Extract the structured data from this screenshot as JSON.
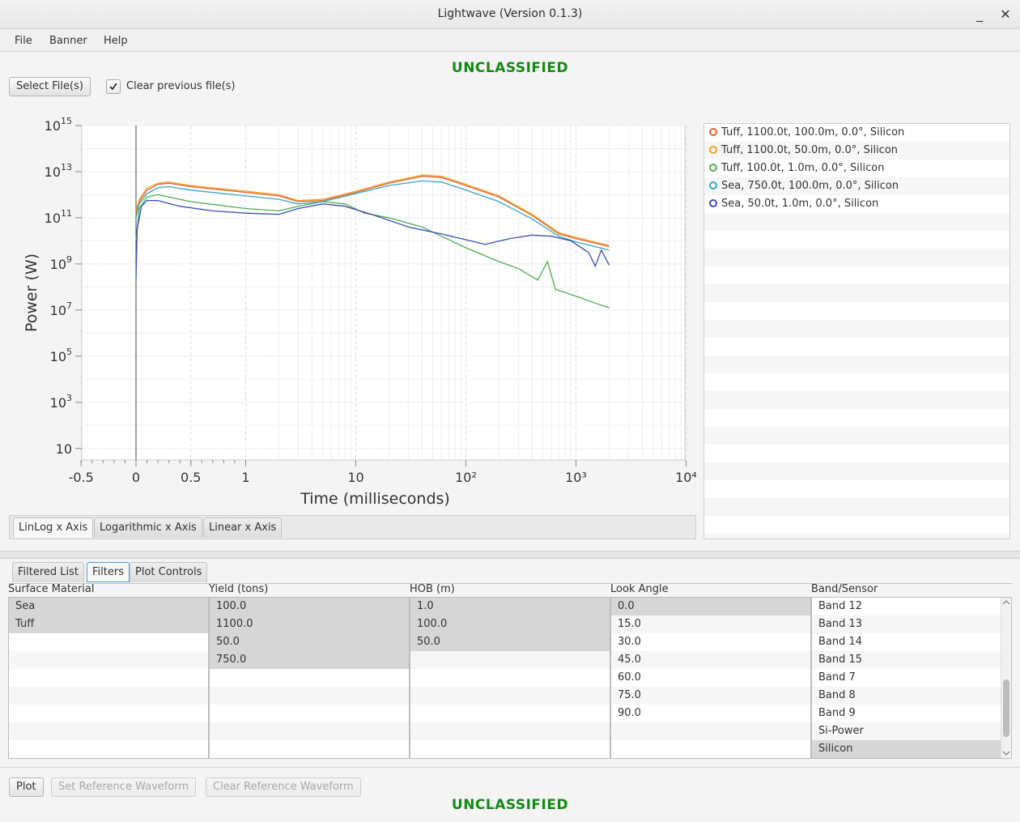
{
  "window": {
    "title": "Lightwave (Version 0.1.3)",
    "minimize": "_",
    "close": "✕"
  },
  "menu": [
    "File",
    "Banner",
    "Help"
  ],
  "banner": {
    "top": "UNCLASSIFIED",
    "bottom": "UNCLASSIFIED"
  },
  "toolbar": {
    "select_files": "Select File(s)",
    "clear_previous": "Clear previous file(s)",
    "clear_previous_checked": true
  },
  "axis_tabs": [
    "LinLog x Axis",
    "Logarithmic x Axis",
    "Linear x Axis"
  ],
  "legend": [
    {
      "label": "Tuff, 1100.0t, 100.0m, 0.0°, Silicon",
      "color": "#e8652b"
    },
    {
      "label": "Tuff, 1100.0t, 50.0m, 0.0°, Silicon",
      "color": "#f0a030"
    },
    {
      "label": "Tuff, 100.0t, 1.0m, 0.0°, Silicon",
      "color": "#4caf50"
    },
    {
      "label": "Sea, 750.0t, 100.0m, 0.0°, Silicon",
      "color": "#35a6c8"
    },
    {
      "label": "Sea, 50.0t, 1.0m, 0.0°, Silicon",
      "color": "#3c4fb4"
    }
  ],
  "chart_data": {
    "type": "line",
    "xlabel": "Time (milliseconds)",
    "ylabel": "Power (W)",
    "x_scale": "linlog",
    "y_scale": "log",
    "x_ticks": [
      "-0.5",
      "0",
      "0.5",
      "1",
      "10",
      "10²",
      "10³",
      "10⁴"
    ],
    "y_ticks": [
      {
        "base": "10",
        "exp": "15"
      },
      {
        "base": "10",
        "exp": "13"
      },
      {
        "base": "10",
        "exp": "11"
      },
      {
        "base": "10",
        "exp": "9"
      },
      {
        "base": "10",
        "exp": "7"
      },
      {
        "base": "10",
        "exp": "5"
      },
      {
        "base": "10",
        "exp": "3"
      },
      {
        "base": "10",
        "exp": ""
      }
    ],
    "ylim_log10": [
      0.5,
      15
    ],
    "grid": true,
    "series": [
      {
        "name": "Tuff, 1100.0t, 100.0m, 0.0°, Silicon",
        "color": "#e8652b",
        "points": [
          [
            0,
            11.2
          ],
          [
            0.03,
            11.7
          ],
          [
            0.1,
            12.2
          ],
          [
            0.2,
            12.45
          ],
          [
            0.3,
            12.5
          ],
          [
            0.5,
            12.35
          ],
          [
            1,
            12.1
          ],
          [
            2,
            11.95
          ],
          [
            3,
            11.7
          ],
          [
            5,
            11.75
          ],
          [
            10,
            12.1
          ],
          [
            20,
            12.5
          ],
          [
            40,
            12.8
          ],
          [
            60,
            12.75
          ],
          [
            100,
            12.4
          ],
          [
            200,
            11.9
          ],
          [
            400,
            11.1
          ],
          [
            700,
            10.3
          ],
          [
            1000,
            10.1
          ],
          [
            2000,
            9.75
          ]
        ]
      },
      {
        "name": "Tuff, 1100.0t, 50.0m, 0.0°, Silicon",
        "color": "#f0a030",
        "points": [
          [
            0,
            11.3
          ],
          [
            0.03,
            11.8
          ],
          [
            0.1,
            12.3
          ],
          [
            0.2,
            12.5
          ],
          [
            0.3,
            12.55
          ],
          [
            0.5,
            12.4
          ],
          [
            1,
            12.15
          ],
          [
            2,
            12.0
          ],
          [
            3,
            11.75
          ],
          [
            5,
            11.8
          ],
          [
            10,
            12.15
          ],
          [
            20,
            12.55
          ],
          [
            40,
            12.85
          ],
          [
            60,
            12.8
          ],
          [
            100,
            12.45
          ],
          [
            200,
            11.95
          ],
          [
            400,
            11.15
          ],
          [
            700,
            10.35
          ],
          [
            1000,
            10.15
          ],
          [
            2000,
            9.8
          ]
        ]
      },
      {
        "name": "Tuff, 100.0t, 1.0m, 0.0°, Silicon",
        "color": "#4caf50",
        "points": [
          [
            0,
            10.0
          ],
          [
            0.03,
            11.4
          ],
          [
            0.1,
            11.9
          ],
          [
            0.2,
            12.0
          ],
          [
            0.3,
            11.9
          ],
          [
            0.5,
            11.7
          ],
          [
            1,
            11.4
          ],
          [
            2,
            11.3
          ],
          [
            3,
            11.5
          ],
          [
            5,
            11.7
          ],
          [
            8,
            11.6
          ],
          [
            12,
            11.2
          ],
          [
            20,
            11.0
          ],
          [
            40,
            10.6
          ],
          [
            60,
            10.2
          ],
          [
            100,
            9.7
          ],
          [
            200,
            9.1
          ],
          [
            300,
            8.8
          ],
          [
            450,
            8.3
          ],
          [
            550,
            9.1
          ],
          [
            650,
            7.9
          ],
          [
            1000,
            7.6
          ],
          [
            1500,
            7.3
          ],
          [
            2000,
            7.1
          ]
        ]
      },
      {
        "name": "Sea, 750.0t, 100.0m, 0.0°, Silicon",
        "color": "#35a6c8",
        "points": [
          [
            0,
            11.0
          ],
          [
            0.03,
            11.6
          ],
          [
            0.1,
            12.05
          ],
          [
            0.2,
            12.3
          ],
          [
            0.3,
            12.35
          ],
          [
            0.5,
            12.2
          ],
          [
            1,
            11.95
          ],
          [
            2,
            11.8
          ],
          [
            3,
            11.6
          ],
          [
            5,
            11.7
          ],
          [
            10,
            12.05
          ],
          [
            20,
            12.4
          ],
          [
            40,
            12.6
          ],
          [
            60,
            12.55
          ],
          [
            100,
            12.2
          ],
          [
            200,
            11.7
          ],
          [
            400,
            10.95
          ],
          [
            700,
            10.2
          ],
          [
            1000,
            9.95
          ],
          [
            2000,
            9.6
          ]
        ]
      },
      {
        "name": "Sea, 50.0t, 1.0m, 0.0°, Silicon",
        "color": "#3c4fb4",
        "points": [
          [
            0,
            8.3
          ],
          [
            0.01,
            10.5
          ],
          [
            0.05,
            11.5
          ],
          [
            0.1,
            11.75
          ],
          [
            0.2,
            11.75
          ],
          [
            0.4,
            11.5
          ],
          [
            0.7,
            11.3
          ],
          [
            1,
            11.2
          ],
          [
            2,
            11.15
          ],
          [
            3,
            11.4
          ],
          [
            5,
            11.6
          ],
          [
            8,
            11.5
          ],
          [
            15,
            11.1
          ],
          [
            30,
            10.6
          ],
          [
            60,
            10.3
          ],
          [
            100,
            10.05
          ],
          [
            150,
            9.85
          ],
          [
            250,
            10.1
          ],
          [
            400,
            10.25
          ],
          [
            600,
            10.2
          ],
          [
            900,
            10.0
          ],
          [
            1300,
            9.5
          ],
          [
            1500,
            8.9
          ],
          [
            1700,
            9.6
          ],
          [
            2000,
            8.95
          ]
        ]
      }
    ]
  },
  "bottom_tabs": [
    "Filtered List",
    "Filters",
    "Plot Controls"
  ],
  "filters": [
    {
      "header": "Surface Material",
      "items": [
        {
          "text": "Sea",
          "selected": true
        },
        {
          "text": "Tuff",
          "selected": true
        }
      ]
    },
    {
      "header": "Yield (tons)",
      "items": [
        {
          "text": "100.0",
          "selected": true
        },
        {
          "text": "1100.0",
          "selected": true
        },
        {
          "text": "50.0",
          "selected": true
        },
        {
          "text": "750.0",
          "selected": true
        }
      ]
    },
    {
      "header": "HOB (m)",
      "items": [
        {
          "text": "1.0",
          "selected": true
        },
        {
          "text": "100.0",
          "selected": true
        },
        {
          "text": "50.0",
          "selected": true
        }
      ]
    },
    {
      "header": "Look Angle",
      "items": [
        {
          "text": "0.0",
          "selected": true
        },
        {
          "text": "15.0",
          "selected": false
        },
        {
          "text": "30.0",
          "selected": false
        },
        {
          "text": "45.0",
          "selected": false
        },
        {
          "text": "60.0",
          "selected": false
        },
        {
          "text": "75.0",
          "selected": false
        },
        {
          "text": "90.0",
          "selected": false
        }
      ]
    },
    {
      "header": "Band/Sensor",
      "items": [
        {
          "text": "Band 12",
          "selected": false
        },
        {
          "text": "Band 13",
          "selected": false
        },
        {
          "text": "Band 14",
          "selected": false
        },
        {
          "text": "Band 15",
          "selected": false
        },
        {
          "text": "Band 7",
          "selected": false
        },
        {
          "text": "Band 8",
          "selected": false
        },
        {
          "text": "Band 9",
          "selected": false
        },
        {
          "text": "Si-Power",
          "selected": false
        },
        {
          "text": "Silicon",
          "selected": true
        }
      ]
    }
  ],
  "scroll": {
    "band_sensor_position": 0.85,
    "band_sensor_visible": 0.4
  },
  "actions": {
    "plot": "Plot",
    "set_ref": "Set Reference Waveform",
    "clear_ref": "Clear Reference Waveform"
  }
}
